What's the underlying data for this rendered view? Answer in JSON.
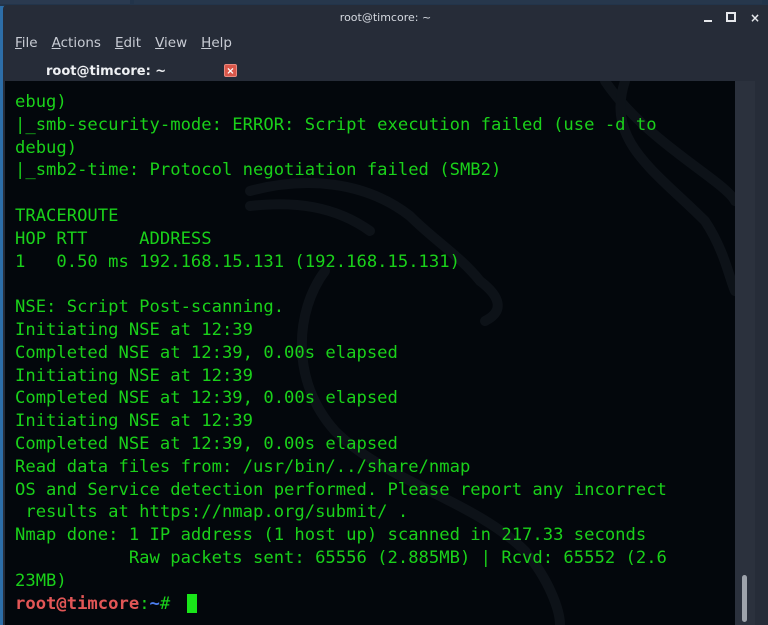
{
  "window": {
    "title": "root@timcore: ~",
    "controls": {
      "minimize": "minimize",
      "maximize": "maximize",
      "close": "×"
    }
  },
  "menubar": {
    "items": [
      {
        "label": "File",
        "mnemonic": "F",
        "rest": "ile"
      },
      {
        "label": "Actions",
        "mnemonic": "A",
        "rest": "ctions"
      },
      {
        "label": "Edit",
        "mnemonic": "E",
        "rest": "dit"
      },
      {
        "label": "View",
        "mnemonic": "V",
        "rest": "iew"
      },
      {
        "label": "Help",
        "mnemonic": "H",
        "rest": "elp"
      }
    ]
  },
  "tabs": [
    {
      "label": "root@timcore: ~",
      "active": true,
      "close_glyph": "×"
    }
  ],
  "colors": {
    "terminal_text": "#1ad11a",
    "prompt_user": "#e25656",
    "prompt_path": "#4c7ef0",
    "tab_indicator": "#2a7de1",
    "tab_close": "#d9574a"
  },
  "terminal": {
    "lines": [
      "ebug)",
      "|_smb-security-mode: ERROR: Script execution failed (use -d to",
      "debug)",
      "|_smb2-time: Protocol negotiation failed (SMB2)",
      "",
      "TRACEROUTE",
      "HOP RTT     ADDRESS",
      "1   0.50 ms 192.168.15.131 (192.168.15.131)",
      "",
      "NSE: Script Post-scanning.",
      "Initiating NSE at 12:39",
      "Completed NSE at 12:39, 0.00s elapsed",
      "Initiating NSE at 12:39",
      "Completed NSE at 12:39, 0.00s elapsed",
      "Initiating NSE at 12:39",
      "Completed NSE at 12:39, 0.00s elapsed",
      "Read data files from: /usr/bin/../share/nmap",
      "OS and Service detection performed. Please report any incorrect",
      " results at https://nmap.org/submit/ .",
      "Nmap done: 1 IP address (1 host up) scanned in 217.33 seconds",
      "           Raw packets sent: 65556 (2.885MB) | Rcvd: 65552 (2.6",
      "23MB)"
    ],
    "prompt": {
      "user_host": "root@timcore",
      "colon": ":",
      "path": "~",
      "symbol": "# "
    }
  },
  "scrollbar": {
    "position_fraction": 1.0
  }
}
